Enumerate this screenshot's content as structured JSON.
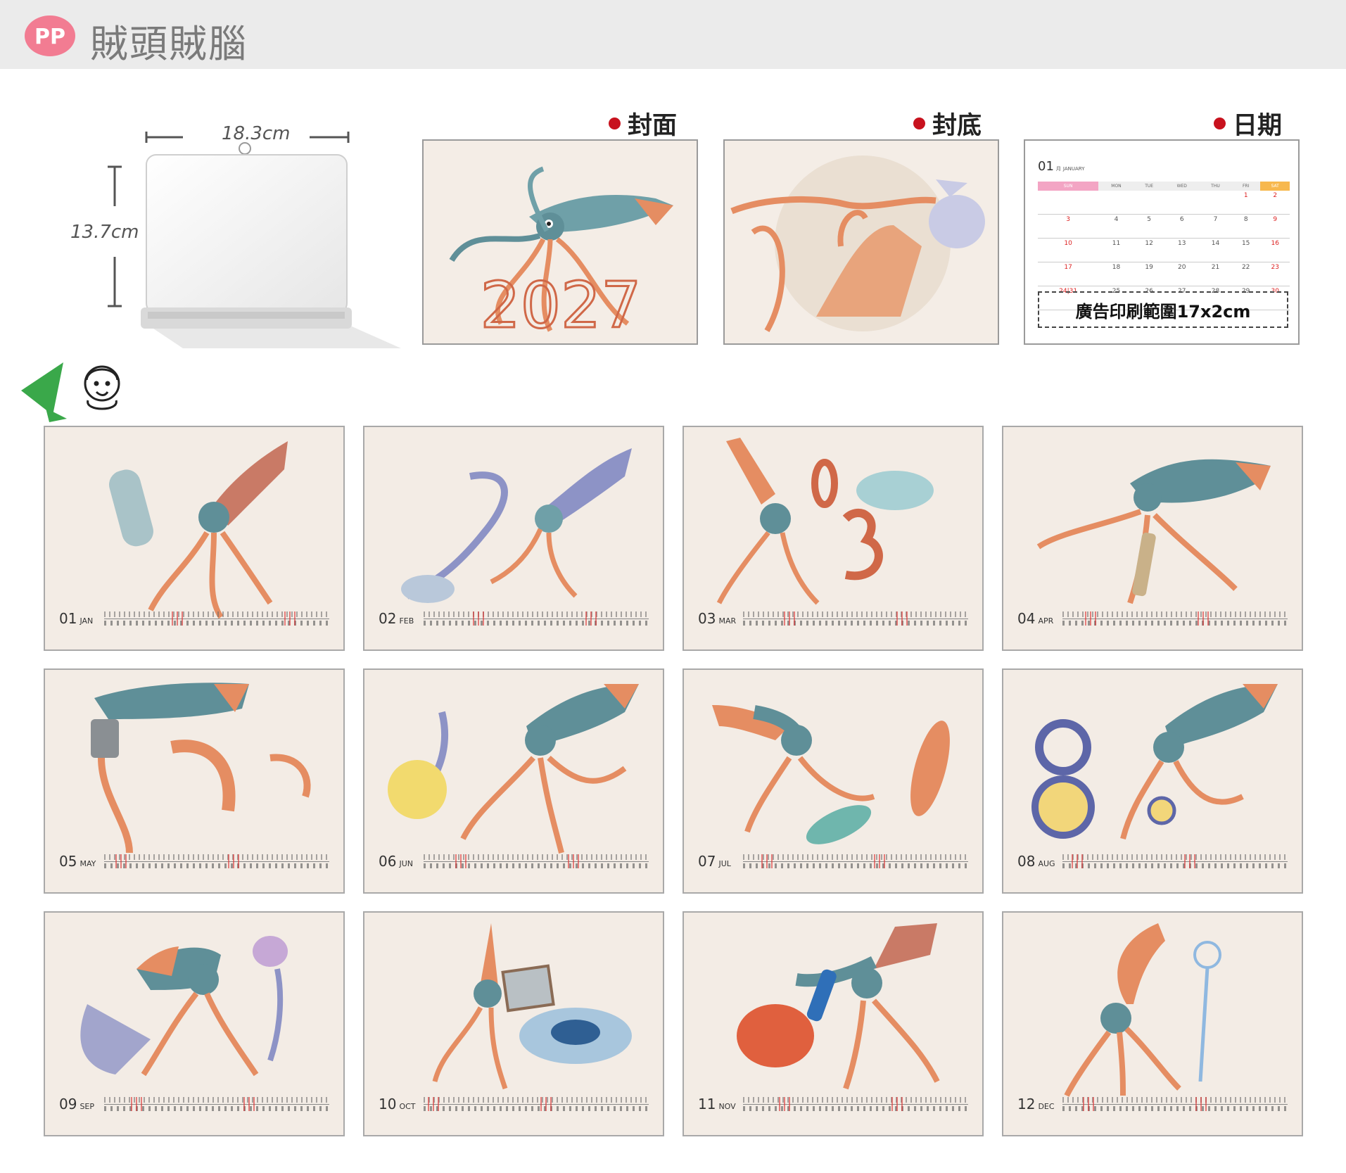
{
  "header": {
    "logo_text": "PP",
    "brand": "賊頭賊腦",
    "logo_color": "#f27c92"
  },
  "stand": {
    "width_label": "18.3cm",
    "height_label": "13.7cm"
  },
  "sections": {
    "cover": "封面",
    "back": "封底",
    "date": "日期"
  },
  "cover_year": "2027",
  "calendar_sample": {
    "month_num": "01",
    "month_unit": "月",
    "month_name": "JANUARY",
    "weekdays": [
      "SUN",
      "MON",
      "TUE",
      "WED",
      "THU",
      "FRI",
      "SAT"
    ],
    "weeks": [
      [
        "",
        "",
        "",
        "",
        "",
        "1",
        "2"
      ],
      [
        "3",
        "4",
        "5",
        "6",
        "7",
        "8",
        "9"
      ],
      [
        "10",
        "11",
        "12",
        "13",
        "14",
        "15",
        "16"
      ],
      [
        "17",
        "18",
        "19",
        "20",
        "21",
        "22",
        "23"
      ],
      [
        "24|31",
        "25",
        "26",
        "27",
        "28",
        "29",
        "30"
      ]
    ],
    "ad_label": "廣告印刷範圍17x2cm"
  },
  "months": [
    {
      "num": "01",
      "name": "JAN"
    },
    {
      "num": "02",
      "name": "FEB"
    },
    {
      "num": "03",
      "name": "MAR"
    },
    {
      "num": "04",
      "name": "APR"
    },
    {
      "num": "05",
      "name": "MAY"
    },
    {
      "num": "06",
      "name": "JUN"
    },
    {
      "num": "07",
      "name": "JUL"
    },
    {
      "num": "08",
      "name": "AUG"
    },
    {
      "num": "09",
      "name": "SEP"
    },
    {
      "num": "10",
      "name": "OCT"
    },
    {
      "num": "11",
      "name": "NOV"
    },
    {
      "num": "12",
      "name": "DEC"
    }
  ],
  "colors": {
    "accent_red": "#c8121e",
    "squid_teal": "#4f8f9c",
    "squid_orange": "#e58d62",
    "paper": "#f3ece5"
  },
  "icons": [
    "pp-logo-icon",
    "red-dot-icon",
    "green-pennant-icon",
    "girl-doodle-icon",
    "squid-illustration"
  ]
}
